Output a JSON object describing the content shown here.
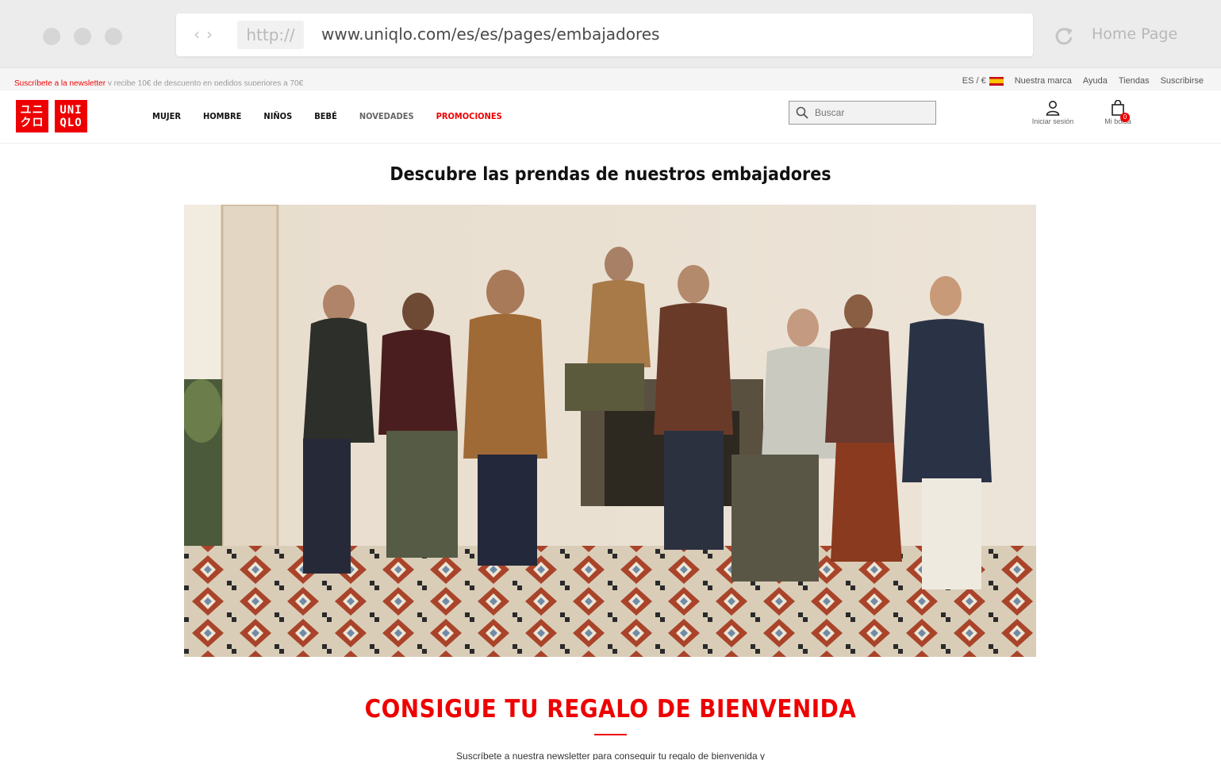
{
  "browser": {
    "protocol": "http://",
    "url": "www.uniqlo.com/es/es/pages/embajadores",
    "home_label": "Home Page"
  },
  "utility": {
    "promo_red": "Suscríbete a la newsletter",
    "promo_rest": " y recibe 10€ de descuento en pedidos superiores a 70€",
    "locale": "ES / €",
    "links": [
      "Nuestra marca",
      "Ayuda",
      "Tiendas",
      "Suscribirse"
    ]
  },
  "logo": {
    "block1_top": "ユニ",
    "block1_bottom": "クロ",
    "block2_top": "UNI",
    "block2_bottom": "QLO"
  },
  "nav": {
    "items": [
      "MUJER",
      "HOMBRE",
      "NIÑOS",
      "BEBÉ",
      "NOVEDADES",
      "PROMOCIONES"
    ]
  },
  "search": {
    "placeholder": "Buscar"
  },
  "account": {
    "login_label": "Iniciar sesión",
    "bag_label": "Mi bolsa",
    "bag_count": "0"
  },
  "main": {
    "title": "Descubre las prendas de nuestros embajadores",
    "gift_title": "CONSIGUE TU REGALO DE BIENVENIDA",
    "gift_sub": "Suscríbete a nuestra newsletter para conseguir tu regalo de bienvenida y"
  },
  "colors": {
    "brand_red": "#e00000"
  }
}
